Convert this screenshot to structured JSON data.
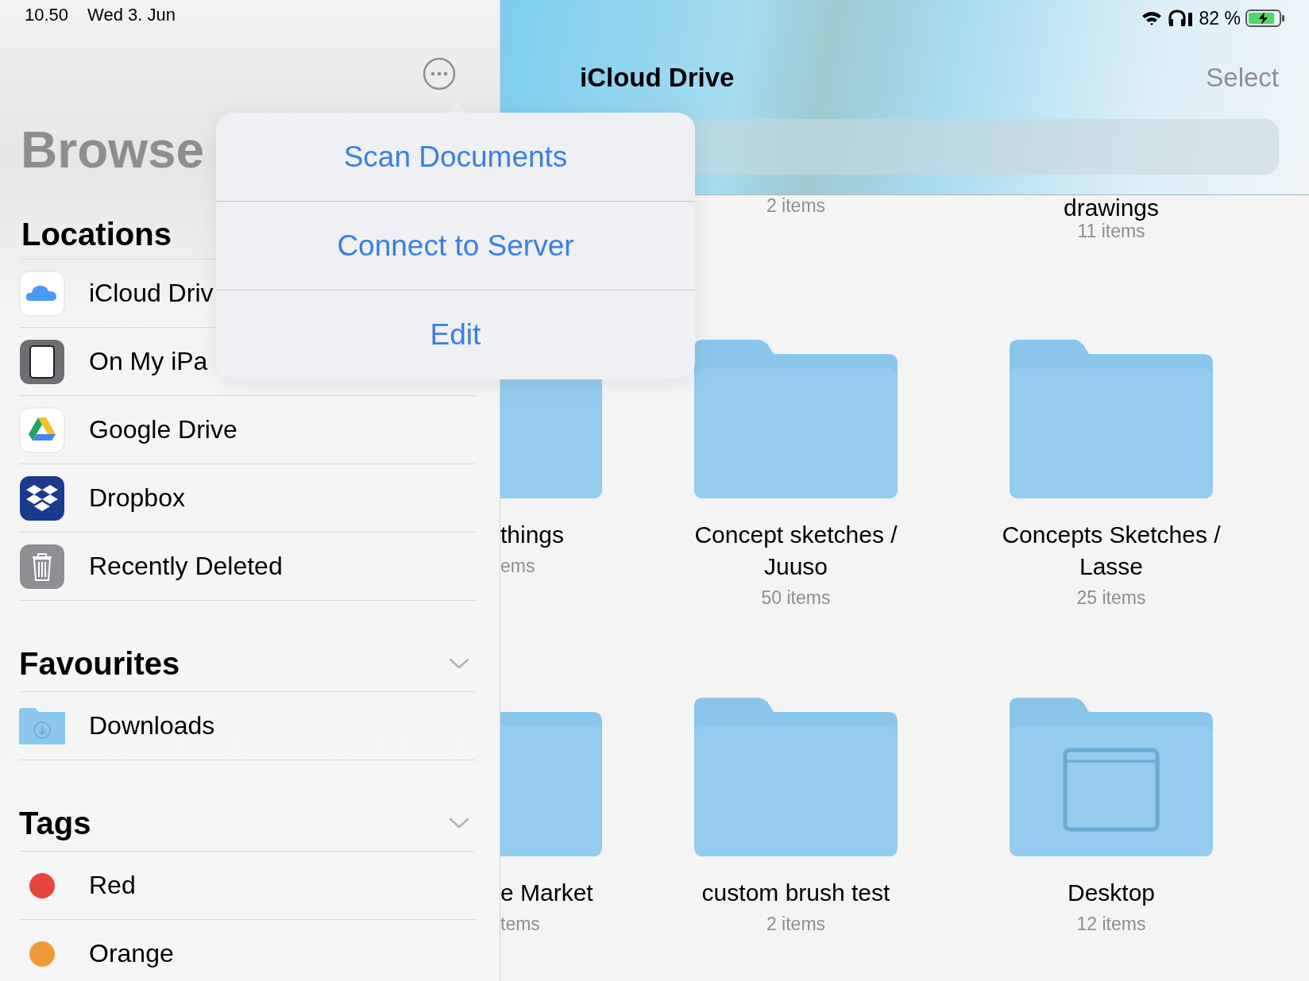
{
  "status_bar": {
    "time": "10.50",
    "date": "Wed 3. Jun",
    "battery": "82 %"
  },
  "sidebar": {
    "title": "Browse",
    "sections": [
      {
        "heading": "Locations",
        "chevron": false,
        "items": [
          {
            "label": "iCloud Driv",
            "kind": "icloud"
          },
          {
            "label": "On My iPa",
            "kind": "ipad"
          },
          {
            "label": "Google Drive",
            "kind": "gdrive"
          },
          {
            "label": "Dropbox",
            "kind": "dropbox"
          },
          {
            "label": "Recently Deleted",
            "kind": "trash"
          }
        ]
      },
      {
        "heading": "Favourites",
        "chevron": true,
        "items": [
          {
            "label": "Downloads",
            "kind": "downloads"
          }
        ]
      },
      {
        "heading": "Tags",
        "chevron": true,
        "items": [
          {
            "label": "Red",
            "kind": "tag",
            "color": "#e8453c"
          },
          {
            "label": "Orange",
            "kind": "tag",
            "color": "#f09a37"
          }
        ]
      }
    ]
  },
  "popover": {
    "items": [
      "Scan Documents",
      "Connect to Server",
      "Edit"
    ]
  },
  "header": {
    "title": "iCloud Drive",
    "action": "Select"
  },
  "grid": [
    [
      {
        "kind": "empty"
      },
      {
        "kind": "label",
        "count": "2 items"
      },
      {
        "kind": "label",
        "name": "drawings",
        "count": "11 items"
      }
    ],
    [
      {
        "kind": "folder",
        "name": "things",
        "count": "ems"
      },
      {
        "kind": "folder",
        "name": "Concept sketches / Juuso",
        "count": "50 items"
      },
      {
        "kind": "folder",
        "name": "Concepts Sketches / Lasse",
        "count": "25 items"
      }
    ],
    [
      {
        "kind": "folder",
        "name": "e Market",
        "count": "tems"
      },
      {
        "kind": "folder",
        "name": "custom brush test",
        "count": "2 items"
      },
      {
        "kind": "desktop",
        "name": "Desktop",
        "count": "12 items"
      }
    ]
  ]
}
